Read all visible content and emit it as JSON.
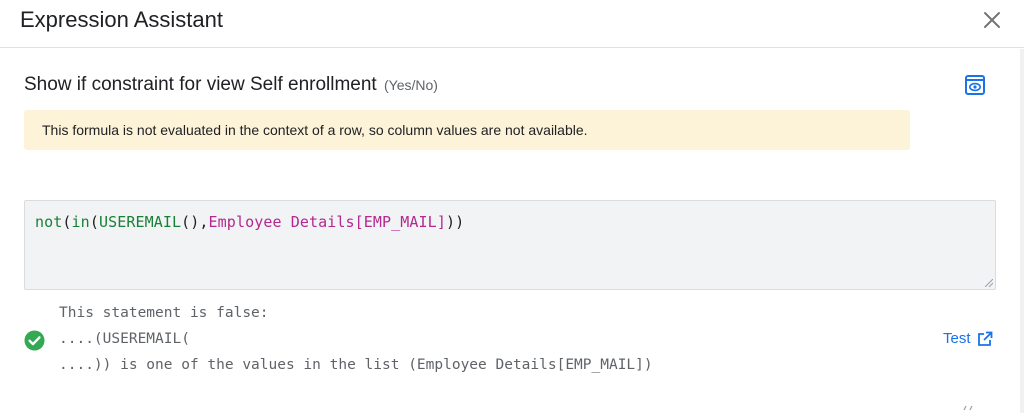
{
  "dialog": {
    "title": "Expression Assistant",
    "close_icon": "close-icon"
  },
  "section": {
    "heading": "Show if constraint for view Self enrollment",
    "type_tag": "(Yes/No)",
    "preview_icon": "preview-icon"
  },
  "warning": {
    "text": "This formula is not evaluated in the context of a row, so column values are not available."
  },
  "editor": {
    "tokens": {
      "not": "not",
      "open1": "(",
      "in": "in",
      "open2": "(",
      "useremail": "USEREMAIL",
      "call": "()",
      "comma": ",",
      "field": "Employee Details[EMP_MAIL]",
      "close": "))"
    }
  },
  "result": {
    "line1": "This statement is false:",
    "line2": "....(USEREMAIL(",
    "line3": "....)) is one of the values in the list (Employee Details[EMP_MAIL])",
    "status_icon": "check-circle-icon"
  },
  "test_link": {
    "label": "Test",
    "icon": "open-in-new-icon"
  },
  "colors": {
    "function": "#1a7f37",
    "field": "#b4288f",
    "link": "#1a73e8",
    "success": "#34a853",
    "warning_bg": "#fdf3d8"
  }
}
